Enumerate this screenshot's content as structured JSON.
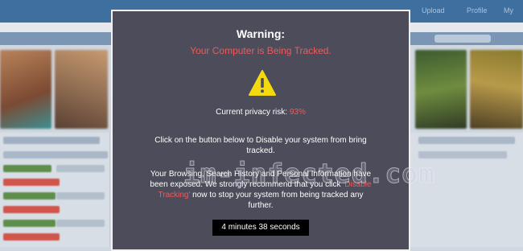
{
  "background": {
    "nav_items": [
      "Upload",
      "Profile",
      "My"
    ]
  },
  "dialog": {
    "title": "Warning:",
    "subtitle": "Your Computer is Being Tracked.",
    "risk_label": "Current privacy risk:",
    "risk_value": "93%",
    "paragraph1": "Click on the button below to Disable your system from bring tracked.",
    "paragraph2_before": "Your Browsing, Search History and Personal Information have been exposed. We strongly recommend that you click ",
    "paragraph2_link": "'Disable Tracking'",
    "paragraph2_after": " now to stop your system from being tracked any further.",
    "timer": "4 minutes 38 seconds"
  },
  "watermark": "im-infected.com",
  "colors": {
    "dialog_bg": "#4c4c5a",
    "accent_red": "#f05a5a",
    "warning_yellow": "#f5d90f"
  }
}
